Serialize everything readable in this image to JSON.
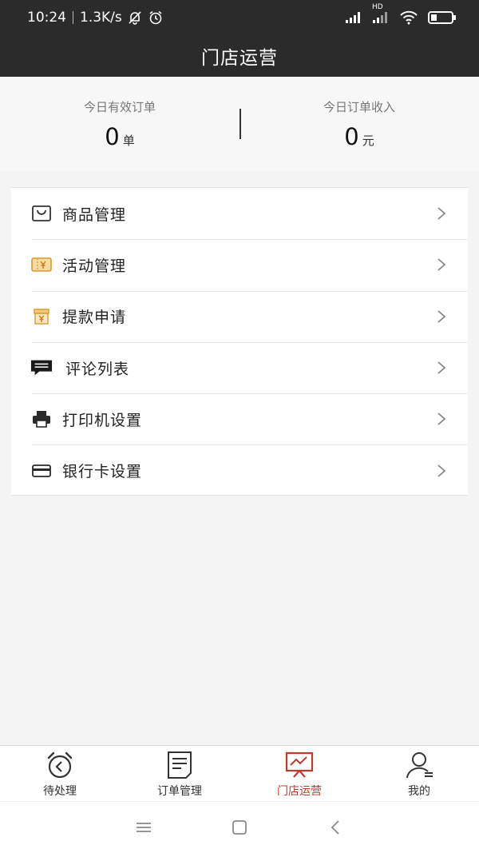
{
  "status_bar": {
    "time": "10:24",
    "speed": "1.3K/s",
    "network_badge": "HD"
  },
  "header": {
    "title": "门店运营"
  },
  "stats": {
    "orders_label": "今日有效订单",
    "orders_value": "0",
    "orders_unit": "单",
    "income_label": "今日订单收入",
    "income_value": "0",
    "income_unit": "元"
  },
  "menu": {
    "items": [
      {
        "label": "商品管理",
        "icon": "bag-icon"
      },
      {
        "label": "活动管理",
        "icon": "ticket-icon"
      },
      {
        "label": "提款申请",
        "icon": "cashbox-icon"
      },
      {
        "label": "评论列表",
        "icon": "comment-icon"
      },
      {
        "label": "打印机设置",
        "icon": "printer-icon"
      },
      {
        "label": "银行卡设置",
        "icon": "card-icon"
      }
    ]
  },
  "tabbar": {
    "tabs": [
      {
        "label": "待处理",
        "icon": "alarm-clock-icon"
      },
      {
        "label": "订单管理",
        "icon": "document-icon"
      },
      {
        "label": "门店运营",
        "icon": "presentation-chart-icon",
        "active": true
      },
      {
        "label": "我的",
        "icon": "user-icon"
      }
    ]
  },
  "colors": {
    "header_bg": "#2b2b2b",
    "accent": "#c0392b",
    "icon_orange": "#e0a030"
  }
}
